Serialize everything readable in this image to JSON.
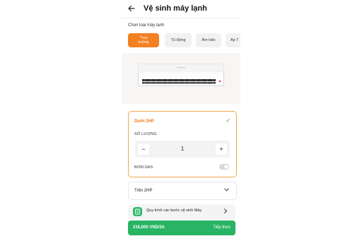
{
  "header": {
    "back_icon": "arrow-left-icon",
    "title": "Vệ sinh máy lạnh"
  },
  "ac_types": {
    "label": "Chọn loại máy lạnh",
    "tabs": [
      {
        "label": "Treo tường",
        "active": true
      },
      {
        "label": "Tủ đứng",
        "active": false
      },
      {
        "label": "Âm trần",
        "active": false
      },
      {
        "label": "Áp T",
        "active": false
      }
    ]
  },
  "options": {
    "under_2hp": {
      "name": "Dưới 2HP",
      "selected": true,
      "quantity_label": "SỐ LƯỢNG",
      "quantity": "1",
      "minus": "−",
      "plus": "+",
      "gas_label": "BƠM GAS",
      "gas_on": false
    },
    "over_2hp": {
      "name": "Trên 2HP"
    }
  },
  "process": {
    "text": "Quy trình các bước vệ sinh Máy"
  },
  "footer": {
    "price": "216,000 VND/1h",
    "next_label": "Tiếp theo"
  },
  "colors": {
    "accent": "#f48024",
    "cta": "#28b464",
    "check": "#28a745"
  }
}
